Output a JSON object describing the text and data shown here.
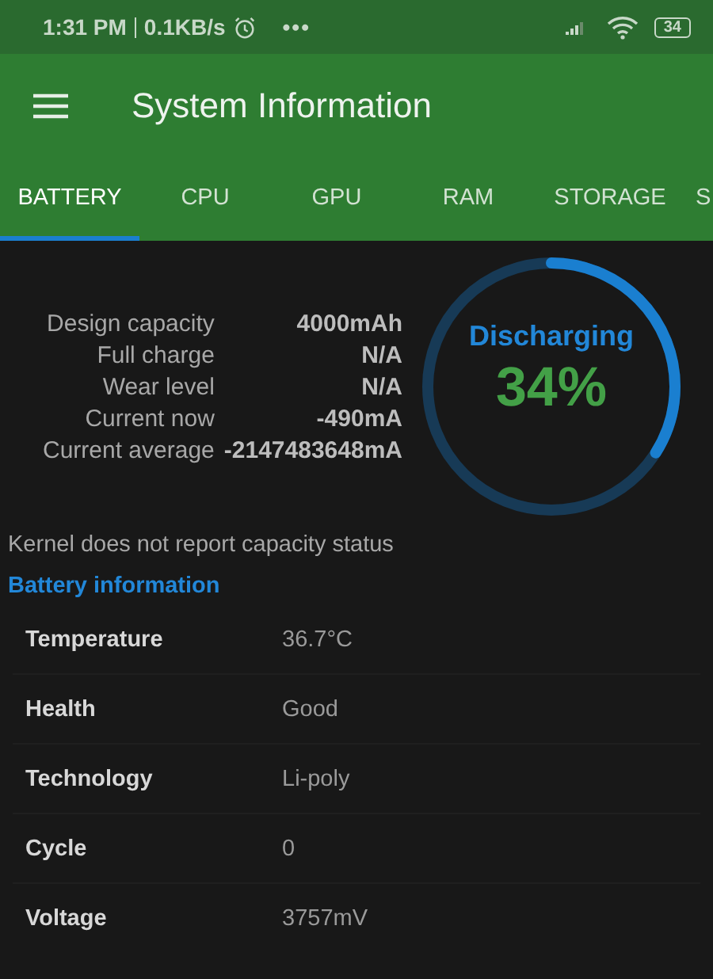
{
  "status_bar": {
    "time": "1:31 PM",
    "speed": "0.1KB/s",
    "more": "•••",
    "battery": "34"
  },
  "app_bar": {
    "title": "System Information"
  },
  "tabs": [
    {
      "label": "BATTERY",
      "selected": true
    },
    {
      "label": "CPU",
      "selected": false
    },
    {
      "label": "GPU",
      "selected": false
    },
    {
      "label": "RAM",
      "selected": false
    },
    {
      "label": "STORAGE",
      "selected": false
    },
    {
      "label": "S",
      "selected": false
    }
  ],
  "summary": [
    {
      "label": "Design capacity",
      "value": "4000mAh"
    },
    {
      "label": "Full charge",
      "value": "N/A"
    },
    {
      "label": "Wear level",
      "value": "N/A"
    },
    {
      "label": "Current now",
      "value": "-490mA"
    },
    {
      "label": "Current average",
      "value": "-2147483648mA"
    }
  ],
  "gauge": {
    "status": "Discharging",
    "percent": "34%",
    "level": 0.34
  },
  "note": "Kernel does not report capacity status",
  "section_title": "Battery information",
  "info_rows": [
    {
      "label": "Temperature",
      "value": "36.7°C"
    },
    {
      "label": "Health",
      "value": "Good"
    },
    {
      "label": "Technology",
      "value": "Li-poly"
    },
    {
      "label": "Cycle",
      "value": "0"
    },
    {
      "label": "Voltage",
      "value": "3757mV"
    }
  ]
}
